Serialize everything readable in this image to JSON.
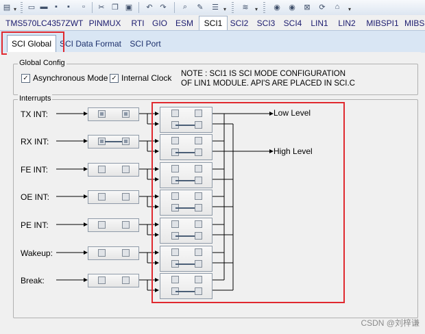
{
  "toolbar": {
    "icons": [
      "app-menu-icon",
      "new-icon",
      "open-icon",
      "save-icon",
      "save-all-icon",
      "cut-icon",
      "copy-icon",
      "paste-icon",
      "undo-icon",
      "redo-icon",
      "search-icon",
      "edit-icon",
      "list-icon",
      "nav-back-icon",
      "nav-forward-icon",
      "stop-icon",
      "refresh-icon",
      "home-icon"
    ]
  },
  "main_tabs": [
    "TMS570LC4357ZWT",
    "PINMUX",
    "RTI",
    "GIO",
    "ESM",
    "SCI1",
    "SCI2",
    "SCI3",
    "SCI4",
    "LIN1",
    "LIN2",
    "MIBSPI1",
    "MIBS"
  ],
  "active_main_tab": "SCI1",
  "sub_tabs": [
    "SCI Global",
    "SCI Data Format",
    "SCI Port"
  ],
  "active_sub_tab": "SCI Global",
  "global_config": {
    "title": "Global Config",
    "async_label": "Asynchronous Mode",
    "internal_clock_label": "Internal Clock",
    "note_line1": "NOTE : SCI1 IS SCI MODE CONFIGURATION",
    "note_line2": "OF LIN1 MODULE. API'S ARE PLACED IN SCI.C"
  },
  "interrupts": {
    "title": "Interrupts",
    "rows": [
      {
        "label": "TX INT:",
        "enabled": true
      },
      {
        "label": "RX INT:",
        "enabled": true
      },
      {
        "label": "FE INT:",
        "enabled": false
      },
      {
        "label": "OE INT:",
        "enabled": false
      },
      {
        "label": "PE INT:",
        "enabled": false
      },
      {
        "label": "Wakeup:",
        "enabled": false
      },
      {
        "label": "Break:",
        "enabled": false
      }
    ],
    "low_level": "Low Level",
    "high_level": "High Level"
  },
  "watermark": "CSDN @刘梓谦",
  "colors": {
    "highlight": "#e0282e",
    "subtab_bar": "#d9e6f4"
  }
}
